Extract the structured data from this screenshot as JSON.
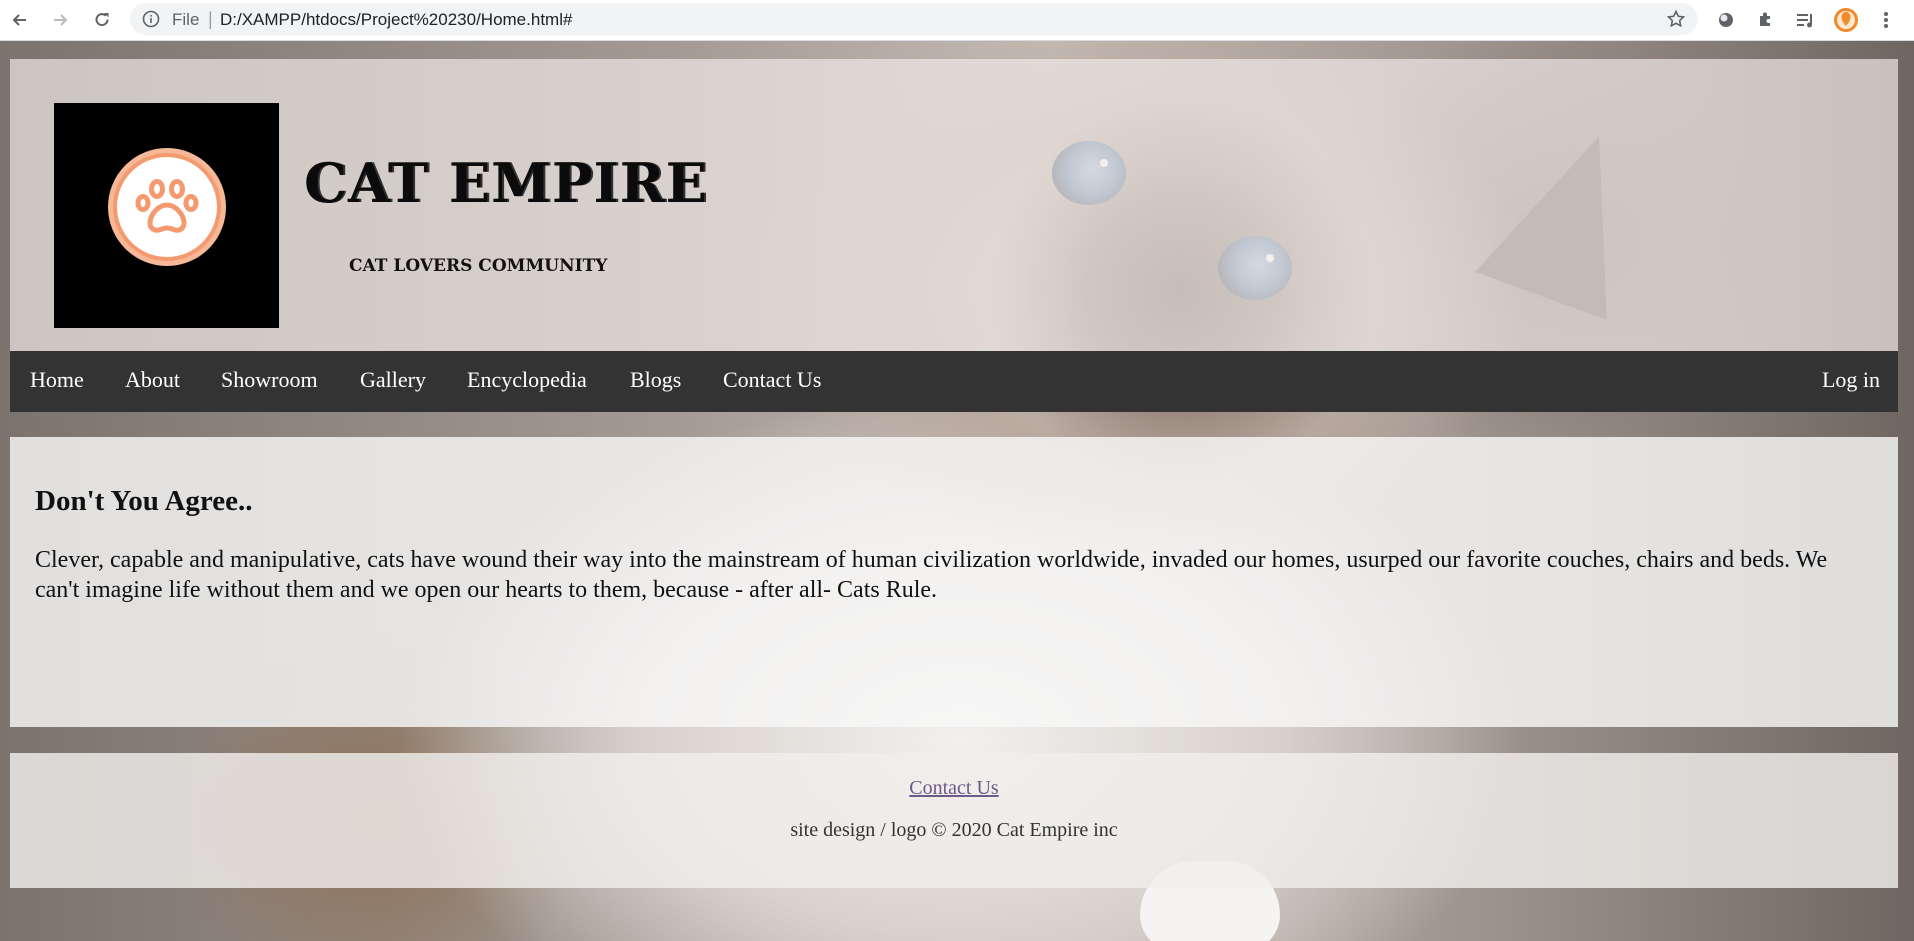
{
  "browser": {
    "omnibox_prefix": "File",
    "url": "D:/XAMPP/htdocs/Project%20230/Home.html#",
    "icons": [
      "back-icon",
      "forward-icon",
      "reload-icon",
      "info-icon",
      "star-icon",
      "extension-circle-icon",
      "puzzle-icon",
      "media-queue-icon",
      "profile-avatar-icon",
      "menu-dots-icon"
    ]
  },
  "header": {
    "title": "CAT EMPIRE",
    "tagline": "CAT LOVERS COMMUNITY",
    "logo_icon": "paw-icon",
    "logo_colors": {
      "ring": "#f49a6e",
      "paw": "#f49a6e",
      "background": "#000000"
    }
  },
  "nav": {
    "items": [
      "Home",
      "About",
      "Showroom",
      "Gallery",
      "Encyclopedia",
      "Blogs",
      "Contact Us"
    ],
    "login": "Log in",
    "bar_color": "#333333"
  },
  "main": {
    "heading": "Don't You Agree..",
    "body": "Clever, capable and manipulative, cats have wound their way into the mainstream of human civilization worldwide, invaded our homes, usurped our favorite couches, chairs and beds. We can't imagine life without them and we open our hearts to them, because - after all- Cats Rule."
  },
  "footer": {
    "link": "Contact Us",
    "copyright": "site design / logo © 2020 Cat Empire inc"
  }
}
